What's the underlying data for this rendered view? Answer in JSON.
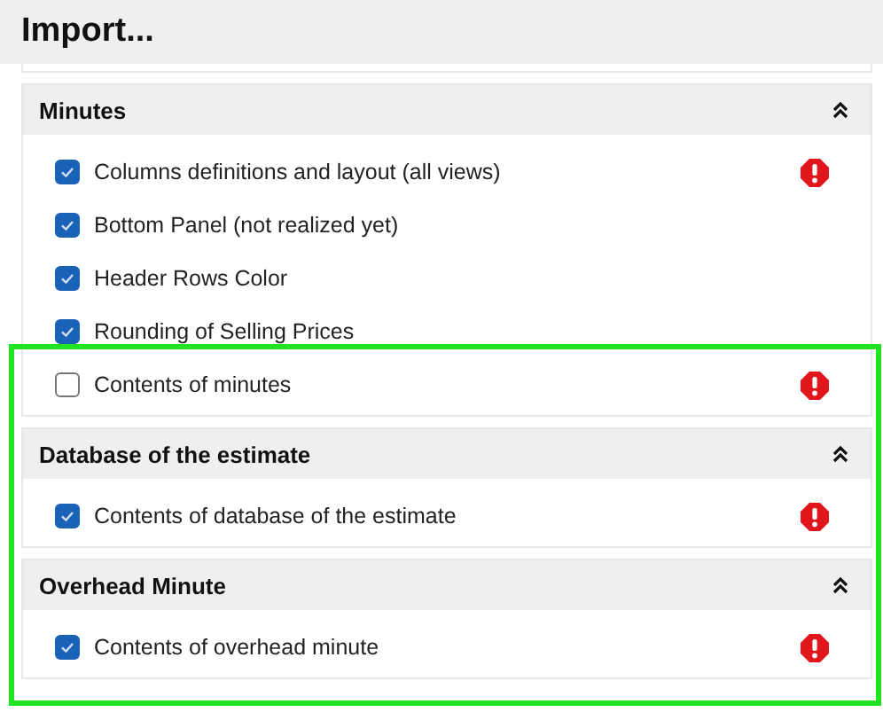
{
  "title": "Import...",
  "sections": [
    {
      "title": "Minutes",
      "expanded": true,
      "items": [
        {
          "label": "Columns definitions and layout (all views)",
          "checked": true,
          "warning": true
        },
        {
          "label": "Bottom Panel (not realized yet)",
          "checked": true,
          "warning": false
        },
        {
          "label": "Header Rows Color",
          "checked": true,
          "warning": false
        },
        {
          "label": "Rounding of Selling Prices",
          "checked": true,
          "warning": false
        },
        {
          "label": "Contents of minutes",
          "checked": false,
          "warning": true
        }
      ]
    },
    {
      "title": "Database of the estimate",
      "expanded": true,
      "items": [
        {
          "label": "Contents of database of the estimate",
          "checked": true,
          "warning": true
        }
      ]
    },
    {
      "title": "Overhead Minute",
      "expanded": true,
      "items": [
        {
          "label": "Contents of overhead minute",
          "checked": true,
          "warning": true
        }
      ]
    }
  ]
}
